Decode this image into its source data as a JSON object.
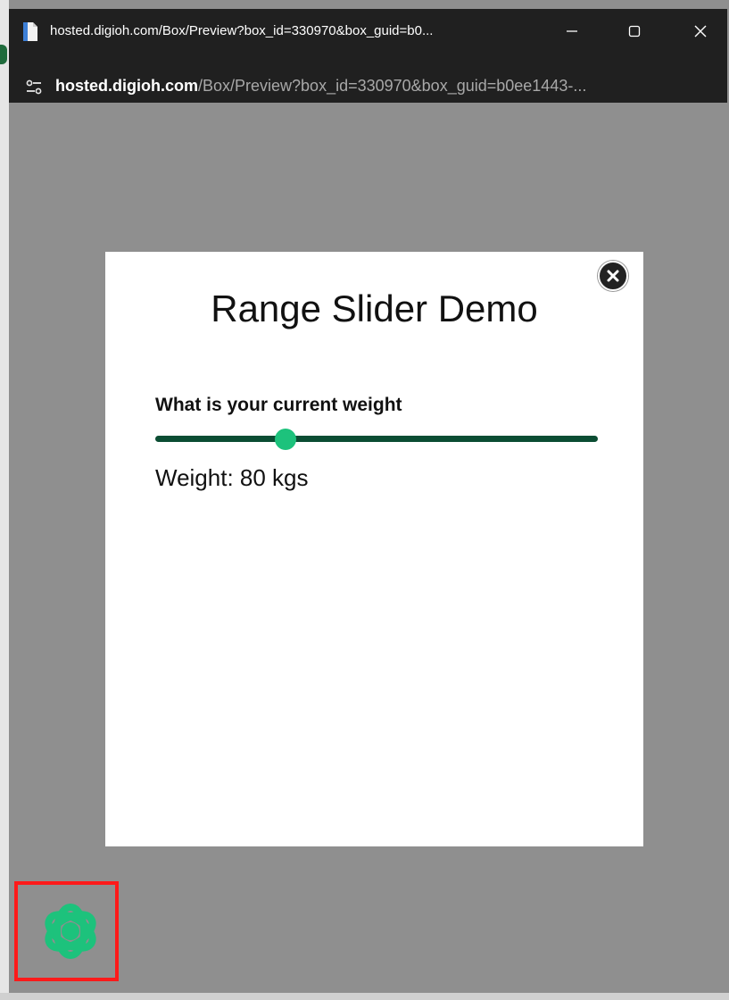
{
  "window": {
    "title": "hosted.digioh.com/Box/Preview?box_id=330970&box_guid=b0...",
    "minimize_label": "minimize",
    "maximize_label": "maximize",
    "close_label": "close"
  },
  "address_bar": {
    "host": "hosted.digioh.com",
    "path": "/Box/Preview?box_id=330970&box_guid=b0ee1443-..."
  },
  "modal": {
    "title": "Range Slider Demo",
    "question": "What is your current weight",
    "value_text": "Weight: 80 kgs",
    "slider": {
      "value_fraction": 0.295
    }
  },
  "colors": {
    "slider_track": "#0b4d33",
    "slider_thumb": "#1dc27c",
    "logo": "#1dc27c",
    "highlight_border": "#ff1a1a"
  },
  "icons": {
    "page": "page-icon",
    "site_info": "site-settings-icon",
    "close_modal": "close-circle-icon",
    "logo": "flower-logo-icon"
  }
}
